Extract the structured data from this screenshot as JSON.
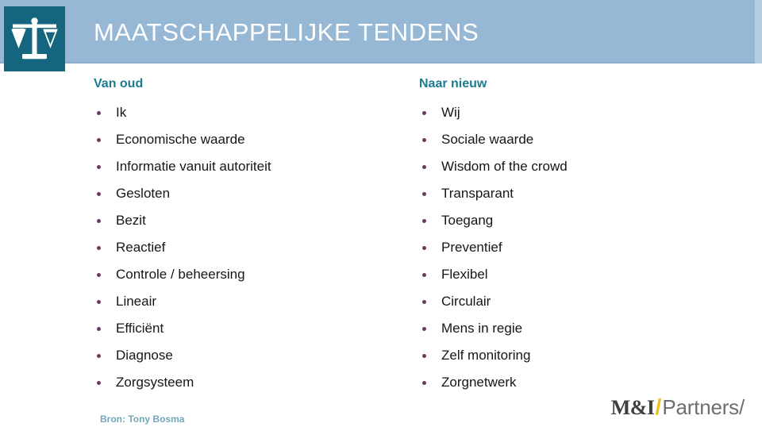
{
  "header": {
    "title": "MAATSCHAPPELIJKE TENDENS",
    "band_color": "#96b8d4",
    "logo_mark_color": "#15657f",
    "logo_mark_icon": "scales-of-justice-icon",
    "title_color": "#ffffff"
  },
  "theme": {
    "heading_color": "#1b7b91",
    "bullet_color": "#6a3a5d",
    "body_text_color": "#161616",
    "source_color": "#74a7b9",
    "accent_gold": "#edc01f"
  },
  "columns": {
    "left": {
      "heading": "Van oud",
      "items": [
        "Ik",
        "Economische waarde",
        "Informatie vanuit autoriteit",
        "Gesloten",
        "Bezit",
        "Reactief",
        "Controle / beheersing",
        "Lineair",
        "Efficiënt",
        "Diagnose",
        "Zorgsysteem"
      ]
    },
    "right": {
      "heading": "Naar nieuw",
      "items": [
        "Wij",
        "Sociale waarde",
        "Wisdom of the crowd",
        "Transparant",
        "Toegang",
        "Preventief",
        "Flexibel",
        "Circulair",
        "Mens in regie",
        "Zelf monitoring",
        "Zorgnetwerk"
      ]
    }
  },
  "footer": {
    "source": "Bron: Tony Bosma",
    "partner_logo": {
      "mi": "M&I",
      "slash": "/",
      "partners": "Partners/"
    }
  }
}
